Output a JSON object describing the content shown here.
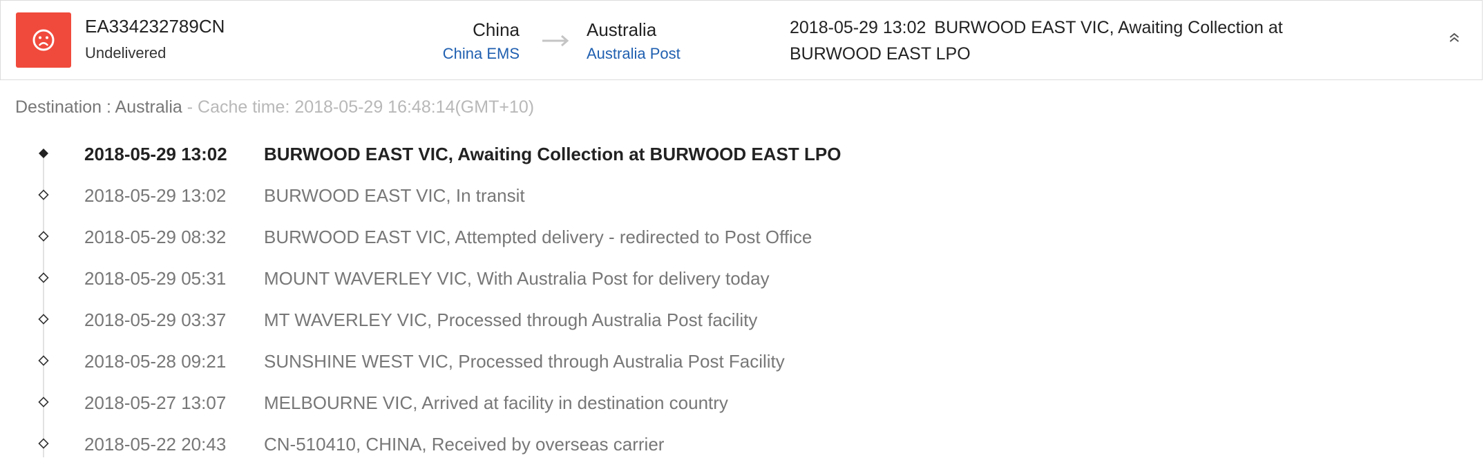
{
  "shipment": {
    "tracking_number": "EA334232789CN",
    "status": "Undelivered",
    "status_color": "#f04a3c",
    "status_icon": "sad-face-icon"
  },
  "route": {
    "origin_country": "China",
    "origin_carrier": "China EMS",
    "destination_country": "Australia",
    "destination_carrier": "Australia Post",
    "arrow_icon": "right-arrow-icon",
    "carrier_link_color": "#1f5fb0"
  },
  "latest": {
    "time": "2018-05-29 13:02",
    "description": "BURWOOD EAST VIC, Awaiting Collection at BURWOOD EAST LPO"
  },
  "toggle": {
    "icon": "collapse-chevron-icon"
  },
  "cache": {
    "destination_text": "Destination : Australia",
    "cache_text": " - Cache time: 2018-05-29 16:48:14(GMT+10)"
  },
  "events": [
    {
      "time": "2018-05-29 13:02",
      "description": "BURWOOD EAST VIC, Awaiting Collection at BURWOOD EAST LPO",
      "latest": true
    },
    {
      "time": "2018-05-29 13:02",
      "description": "BURWOOD EAST VIC, In transit",
      "latest": false
    },
    {
      "time": "2018-05-29 08:32",
      "description": "BURWOOD EAST VIC, Attempted delivery - redirected to Post Office",
      "latest": false
    },
    {
      "time": "2018-05-29 05:31",
      "description": "MOUNT WAVERLEY VIC, With Australia Post for delivery today",
      "latest": false
    },
    {
      "time": "2018-05-29 03:37",
      "description": "MT WAVERLEY VIC, Processed through Australia Post facility",
      "latest": false
    },
    {
      "time": "2018-05-28 09:21",
      "description": "SUNSHINE WEST VIC, Processed through Australia Post Facility",
      "latest": false
    },
    {
      "time": "2018-05-27 13:07",
      "description": "MELBOURNE VIC, Arrived at facility in destination country",
      "latest": false
    },
    {
      "time": "2018-05-22 20:43",
      "description": "CN-510410, CHINA, Received by overseas carrier",
      "latest": false
    }
  ]
}
